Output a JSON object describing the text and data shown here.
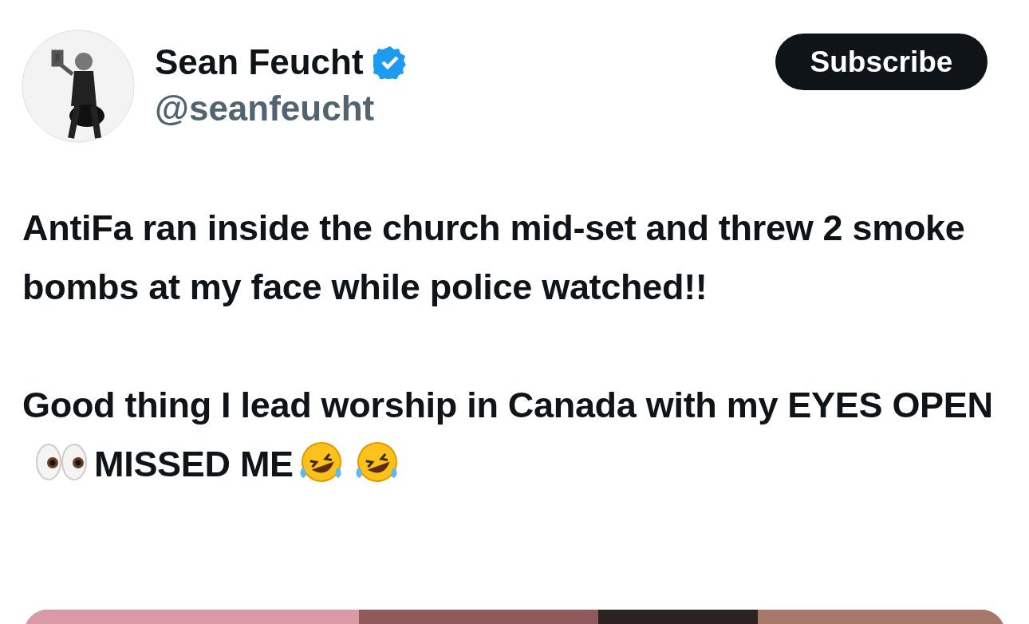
{
  "author": {
    "name": "Sean Feucht",
    "verified": true,
    "handle": "@seanfeucht"
  },
  "subscribe_button": {
    "label": "Subscribe"
  },
  "post": {
    "paragraphs": [
      [
        {
          "kind": "text",
          "text": "AntiFa ran inside the church mid-set and threw 2 smoke bombs at my face while police watched!!"
        }
      ],
      [
        {
          "kind": "text",
          "text": "Good thing I lead worship in Canada with my EYES OPEN"
        },
        {
          "kind": "eyes"
        },
        {
          "kind": "text",
          "text": "MISSED ME"
        },
        {
          "kind": "laugh"
        },
        {
          "kind": "laugh"
        }
      ]
    ]
  }
}
